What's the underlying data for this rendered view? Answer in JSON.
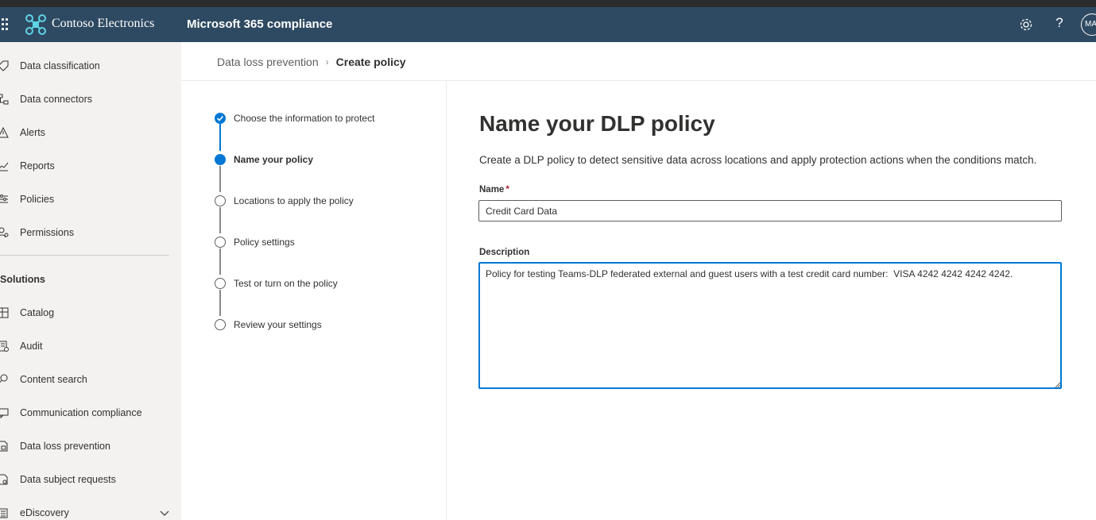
{
  "header": {
    "brand": "Contoso Electronics",
    "app_title": "Microsoft 365 compliance",
    "avatar_initials": "MA",
    "help_label": "?",
    "bg_color": "#2e4a62"
  },
  "sidebar": {
    "items_top": [
      {
        "label": "Data classification",
        "icon": "tag-icon"
      },
      {
        "label": "Data connectors",
        "icon": "connector-icon"
      },
      {
        "label": "Alerts",
        "icon": "alert-icon"
      },
      {
        "label": "Reports",
        "icon": "chart-icon"
      },
      {
        "label": "Policies",
        "icon": "policies-icon"
      },
      {
        "label": "Permissions",
        "icon": "permissions-icon"
      }
    ],
    "section_label": "Solutions",
    "items_solutions": [
      {
        "label": "Catalog",
        "icon": "catalog-icon"
      },
      {
        "label": "Audit",
        "icon": "audit-icon"
      },
      {
        "label": "Content search",
        "icon": "search-icon"
      },
      {
        "label": "Communication compliance",
        "icon": "communication-icon"
      },
      {
        "label": "Data loss prevention",
        "icon": "dlp-icon"
      },
      {
        "label": "Data subject requests",
        "icon": "subject-requests-icon"
      },
      {
        "label": "eDiscovery",
        "icon": "ediscovery-icon"
      }
    ]
  },
  "breadcrumb": {
    "parent": "Data loss prevention",
    "separator": "›",
    "current": "Create policy"
  },
  "wizard": {
    "steps": [
      {
        "label": "Choose the information to protect",
        "state": "done"
      },
      {
        "label": "Name your policy",
        "state": "current"
      },
      {
        "label": "Locations to apply the policy",
        "state": "pending"
      },
      {
        "label": "Policy settings",
        "state": "pending"
      },
      {
        "label": "Test or turn on the policy",
        "state": "pending"
      },
      {
        "label": "Review your settings",
        "state": "pending"
      }
    ],
    "accent_color": "#0078d4"
  },
  "form": {
    "title": "Name your DLP policy",
    "description": "Create a DLP policy to detect sensitive data across locations and apply protection actions when the conditions match.",
    "name_label": "Name",
    "required_mark": "*",
    "name_value": "Credit Card Data",
    "description_label": "Description",
    "description_value": "Policy for testing Teams-DLP federated external and guest users with a test credit card number:  VISA 4242 4242 4242 4242."
  }
}
